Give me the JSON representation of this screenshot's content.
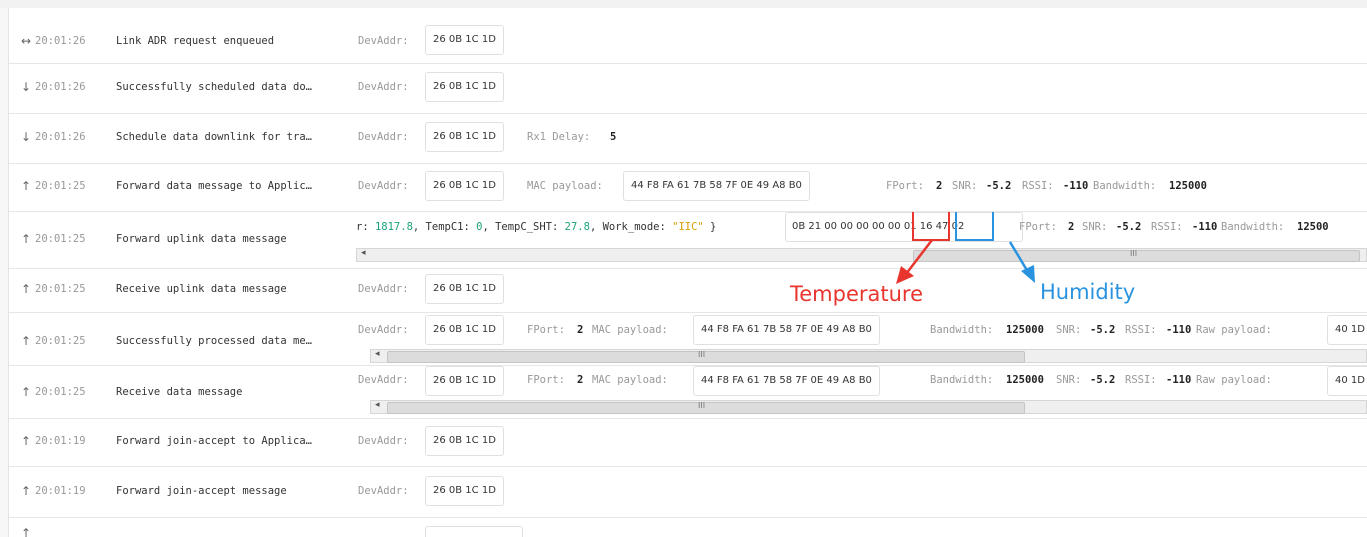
{
  "rows": [
    {
      "arrow": "↔",
      "time": "20:01:26",
      "message": "Link ADR request enqueued",
      "devaddr_label": "DevAddr:",
      "devaddr": "26 0B 1C 1D"
    },
    {
      "arrow": "↓",
      "time": "20:01:26",
      "message": "Successfully scheduled data do…",
      "devaddr_label": "DevAddr:",
      "devaddr": "26 0B 1C 1D"
    },
    {
      "arrow": "↓",
      "time": "20:01:26",
      "message": "Schedule data downlink for tra…",
      "devaddr_label": "DevAddr:",
      "devaddr": "26 0B 1C 1D",
      "rx1_label": "Rx1 Delay:",
      "rx1_value": "5"
    },
    {
      "arrow": "↑",
      "time": "20:01:25",
      "message": "Forward data message to Applic…",
      "devaddr_label": "DevAddr:",
      "devaddr": "26 0B 1C 1D",
      "mac_label": "MAC payload:",
      "mac_payload": "44 F8 FA 61 7B 58 7F 0E 49 A8 B0",
      "fport_label": "FPort:",
      "fport": "2",
      "snr_label": "SNR:",
      "snr": "-5.2",
      "rssi_label": "RSSI:",
      "rssi": "-110",
      "bw_label": "Bandwidth:",
      "bw": "125000"
    },
    {
      "arrow": "↑",
      "time": "20:01:25",
      "message": "Forward uplink data message",
      "decoded": {
        "prefix": "r: ",
        "v1": "1817.8",
        "s1": ", TempC1: ",
        "v2": "0",
        "s2": ", TempC_SHT: ",
        "v3": "27.8",
        "s3": ", Work_mode: ",
        "v4": "\"IIC\"",
        "suffix": " }"
      },
      "raw_payload": {
        "part1": "0B 21 00 00 00 00 00",
        "part2": "01 16",
        "part3": "47 02"
      },
      "fport_label": "FPort:",
      "fport": "2",
      "snr_label": "SNR:",
      "snr": "-5.2",
      "rssi_label": "RSSI:",
      "rssi": "-110",
      "bw_label": "Bandwidth:",
      "bw": "12500"
    },
    {
      "arrow": "↑",
      "time": "20:01:25",
      "message": "Receive uplink data message",
      "devaddr_label": "DevAddr:",
      "devaddr": "26 0B 1C 1D"
    },
    {
      "arrow": "↑",
      "time": "20:01:25",
      "message": "Successfully processed data me…",
      "devaddr_label": "DevAddr:",
      "devaddr": "26 0B 1C 1D",
      "fport_label": "FPort:",
      "fport": "2",
      "mac_label": "MAC payload:",
      "mac_payload": "44 F8 FA 61 7B 58 7F 0E 49 A8 B0",
      "bw_label": "Bandwidth:",
      "bw": "125000",
      "snr_label": "SNR:",
      "snr": "-5.2",
      "rssi_label": "RSSI:",
      "rssi": "-110",
      "raw_label": "Raw payload:",
      "raw_value": "40 1D"
    },
    {
      "arrow": "↑",
      "time": "20:01:25",
      "message": "Receive data message",
      "devaddr_label": "DevAddr:",
      "devaddr": "26 0B 1C 1D",
      "fport_label": "FPort:",
      "fport": "2",
      "mac_label": "MAC payload:",
      "mac_payload": "44 F8 FA 61 7B 58 7F 0E 49 A8 B0",
      "bw_label": "Bandwidth:",
      "bw": "125000",
      "snr_label": "SNR:",
      "snr": "-5.2",
      "rssi_label": "RSSI:",
      "rssi": "-110",
      "raw_label": "Raw payload:",
      "raw_value": "40 1D"
    },
    {
      "arrow": "↑",
      "time": "20:01:19",
      "message": "Forward join-accept to Applica…",
      "devaddr_label": "DevAddr:",
      "devaddr": "26 0B 1C 1D"
    },
    {
      "arrow": "↑",
      "time": "20:01:19",
      "message": "Forward join-accept message",
      "devaddr_label": "DevAddr:",
      "devaddr": "26 0B 1C 1D"
    },
    {
      "arrow": "↑",
      "time": "",
      "message": "",
      "devaddr_label": "",
      "devaddr": ""
    }
  ],
  "annotations": {
    "temperature": {
      "label": "Temperature",
      "color": "#e8352e"
    },
    "humidity": {
      "label": "Humidity",
      "color": "#2a93e0"
    }
  },
  "colors": {
    "number": "#1aa37a",
    "string": "#d4a100"
  },
  "scrollbar_grip": "III"
}
